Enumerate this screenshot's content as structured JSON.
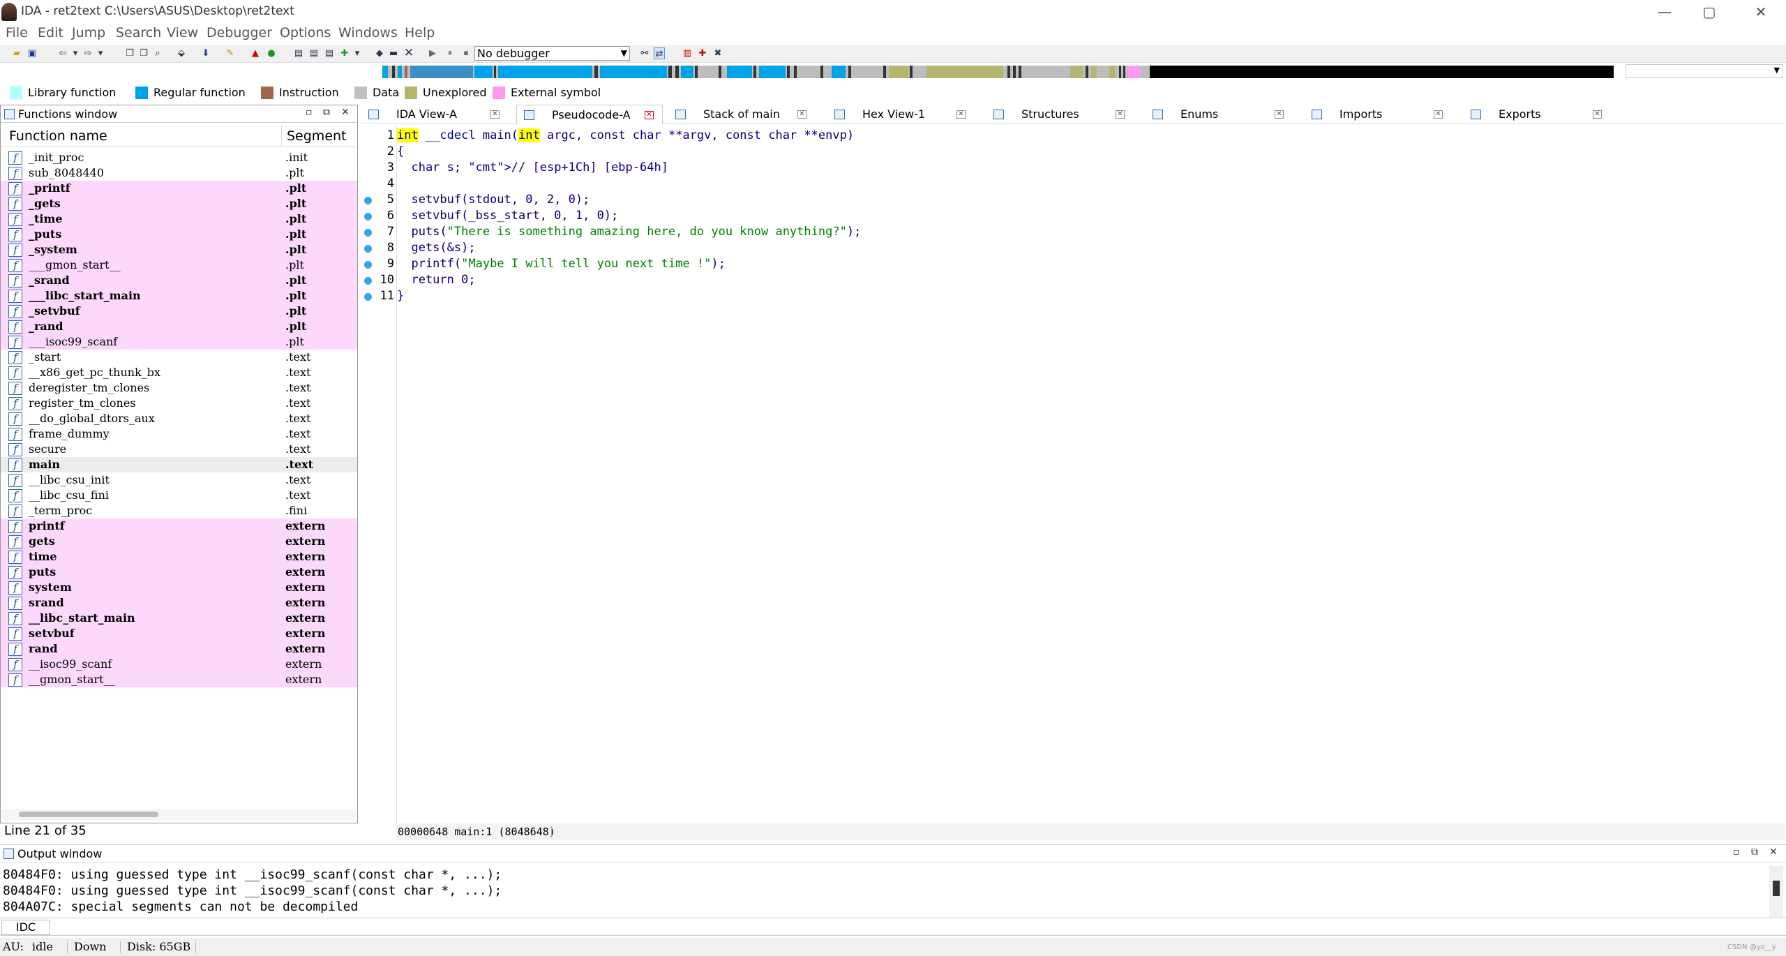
{
  "window": {
    "title": "IDA - ret2text C:\\Users\\ASUS\\Desktop\\ret2text",
    "controls": [
      "—",
      "▢",
      "✕"
    ]
  },
  "menu": [
    "File",
    "Edit",
    "Jump",
    "Search",
    "View",
    "Debugger",
    "Options",
    "Windows",
    "Help"
  ],
  "toolbar": {
    "debugger_select": "No debugger"
  },
  "legend": [
    {
      "label": "Library function",
      "color": "#aaffff"
    },
    {
      "label": "Regular function",
      "color": "#00a2e8"
    },
    {
      "label": "Instruction",
      "color": "#a0664a"
    },
    {
      "label": "Data",
      "color": "#c0c0c0"
    },
    {
      "label": "Unexplored",
      "color": "#b5b56e"
    },
    {
      "label": "External symbol",
      "color": "#ff99ee"
    }
  ],
  "functions_window": {
    "title": "Functions window",
    "col_name": "Function name",
    "col_segment": "Segment",
    "rows": [
      {
        "name": "_init_proc",
        "segment": ".init",
        "style": "normal"
      },
      {
        "name": "sub_8048440",
        "segment": ".plt",
        "style": "normal"
      },
      {
        "name": "_printf",
        "segment": ".plt",
        "style": "lib-bold"
      },
      {
        "name": "_gets",
        "segment": ".plt",
        "style": "lib-bold"
      },
      {
        "name": "_time",
        "segment": ".plt",
        "style": "lib-bold"
      },
      {
        "name": "_puts",
        "segment": ".plt",
        "style": "lib-bold"
      },
      {
        "name": "_system",
        "segment": ".plt",
        "style": "lib-bold"
      },
      {
        "name": "___gmon_start__",
        "segment": ".plt",
        "style": "lib"
      },
      {
        "name": "_srand",
        "segment": ".plt",
        "style": "lib-bold"
      },
      {
        "name": "___libc_start_main",
        "segment": ".plt",
        "style": "lib-bold"
      },
      {
        "name": "_setvbuf",
        "segment": ".plt",
        "style": "lib-bold"
      },
      {
        "name": "_rand",
        "segment": ".plt",
        "style": "lib-bold"
      },
      {
        "name": "___isoc99_scanf",
        "segment": ".plt",
        "style": "lib"
      },
      {
        "name": "_start",
        "segment": ".text",
        "style": "normal"
      },
      {
        "name": "__x86_get_pc_thunk_bx",
        "segment": ".text",
        "style": "normal"
      },
      {
        "name": "deregister_tm_clones",
        "segment": ".text",
        "style": "normal"
      },
      {
        "name": "register_tm_clones",
        "segment": ".text",
        "style": "normal"
      },
      {
        "name": "__do_global_dtors_aux",
        "segment": ".text",
        "style": "normal"
      },
      {
        "name": "frame_dummy",
        "segment": ".text",
        "style": "normal"
      },
      {
        "name": "secure",
        "segment": ".text",
        "style": "normal"
      },
      {
        "name": "main",
        "segment": ".text",
        "style": "selected"
      },
      {
        "name": "__libc_csu_init",
        "segment": ".text",
        "style": "normal"
      },
      {
        "name": "__libc_csu_fini",
        "segment": ".text",
        "style": "normal"
      },
      {
        "name": "_term_proc",
        "segment": ".fini",
        "style": "normal"
      },
      {
        "name": "printf",
        "segment": "extern",
        "style": "lib-bold"
      },
      {
        "name": "gets",
        "segment": "extern",
        "style": "lib-bold"
      },
      {
        "name": "time",
        "segment": "extern",
        "style": "lib-bold"
      },
      {
        "name": "puts",
        "segment": "extern",
        "style": "lib-bold"
      },
      {
        "name": "system",
        "segment": "extern",
        "style": "lib-bold"
      },
      {
        "name": "srand",
        "segment": "extern",
        "style": "lib-bold"
      },
      {
        "name": "__libc_start_main",
        "segment": "extern",
        "style": "lib-bold"
      },
      {
        "name": "setvbuf",
        "segment": "extern",
        "style": "lib-bold"
      },
      {
        "name": "rand",
        "segment": "extern",
        "style": "lib-bold"
      },
      {
        "name": "__isoc99_scanf",
        "segment": "extern",
        "style": "lib"
      },
      {
        "name": "__gmon_start__",
        "segment": "extern",
        "style": "lib"
      }
    ],
    "line_status": "Line 21 of 35"
  },
  "tabs": [
    {
      "label": "IDA View-A",
      "active": false
    },
    {
      "label": "Pseudocode-A",
      "active": true
    },
    {
      "label": "Stack of main",
      "active": false
    },
    {
      "label": "Hex View-1",
      "active": false
    },
    {
      "label": "Structures",
      "active": false
    },
    {
      "label": "Enums",
      "active": false
    },
    {
      "label": "Imports",
      "active": false
    },
    {
      "label": "Exports",
      "active": false
    }
  ],
  "pseudocode": {
    "lines": [
      {
        "num": "1",
        "dot": false,
        "text": "int __cdecl main(int argc, const char **argv, const char **envp)"
      },
      {
        "num": "2",
        "dot": false,
        "text": "{"
      },
      {
        "num": "3",
        "dot": false,
        "text": "  char s; // [esp+1Ch] [ebp-64h]"
      },
      {
        "num": "4",
        "dot": false,
        "text": ""
      },
      {
        "num": "5",
        "dot": true,
        "text": "  setvbuf(stdout, 0, 2, 0);"
      },
      {
        "num": "6",
        "dot": true,
        "text": "  setvbuf(_bss_start, 0, 1, 0);"
      },
      {
        "num": "7",
        "dot": true,
        "text": "  puts(\"There is something amazing here, do you know anything?\");"
      },
      {
        "num": "8",
        "dot": true,
        "text": "  gets(&s);"
      },
      {
        "num": "9",
        "dot": true,
        "text": "  printf(\"Maybe I will tell you next time !\");"
      },
      {
        "num": "10",
        "dot": true,
        "text": "  return 0;"
      },
      {
        "num": "11",
        "dot": true,
        "text": "}"
      }
    ],
    "status_addr": "00000648",
    "status_loc": "main:1 (8048648)"
  },
  "output_window": {
    "title": "Output window",
    "lines": [
      "80484F0: using guessed type int __isoc99_scanf(const char *, ...);",
      "80484F0: using guessed type int __isoc99_scanf(const char *, ...);",
      "804A07C: special segments can not be decompiled"
    ],
    "idc_label": "IDC"
  },
  "statusbar": {
    "au": "AU:",
    "state": "idle",
    "direction": "Down",
    "disk": "Disk: 65GB"
  },
  "watermark": "CSDN @yo__y"
}
